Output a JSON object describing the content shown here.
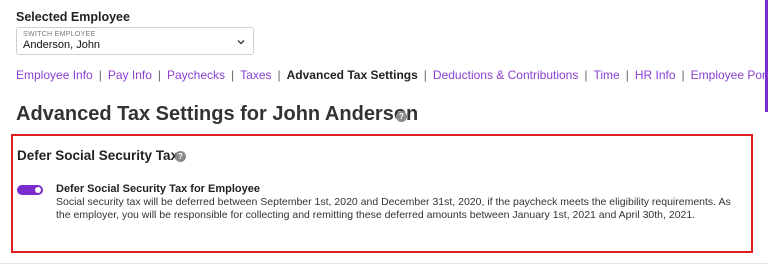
{
  "employee_selector": {
    "heading": "Selected Employee",
    "small_label": "SWITCH EMPLOYEE",
    "value": "Anderson, John"
  },
  "nav": {
    "items": [
      {
        "label": "Employee Info",
        "active": false
      },
      {
        "label": "Pay Info",
        "active": false
      },
      {
        "label": "Paychecks",
        "active": false
      },
      {
        "label": "Taxes",
        "active": false
      },
      {
        "label": "Advanced Tax Settings",
        "active": true
      },
      {
        "label": "Deductions & Contributions",
        "active": false
      },
      {
        "label": "Time",
        "active": false
      },
      {
        "label": "HR Info",
        "active": false
      },
      {
        "label": "Employee Portal",
        "active": false
      }
    ],
    "separator": "|"
  },
  "page": {
    "title": "Advanced Tax Settings for John Anderson",
    "help_glyph": "?"
  },
  "section": {
    "title": "Defer Social Security Tax",
    "help_glyph": "?",
    "setting": {
      "name": "Defer Social Security Tax for Employee",
      "description": "Social security tax will be deferred between September 1st, 2020 and December 31st, 2020, if the paycheck meets the eligibility requirements. As the employer, you will be responsible for collecting and remitting these deferred amounts between January 1st, 2021 and April 30th, 2021.",
      "enabled": true
    }
  },
  "colors": {
    "accent": "#7b2ccf",
    "link": "#8a3fd1",
    "highlight": "#e01e1e"
  },
  "icons": {
    "dropdown": "chevron-down-icon",
    "help": "help-icon"
  }
}
